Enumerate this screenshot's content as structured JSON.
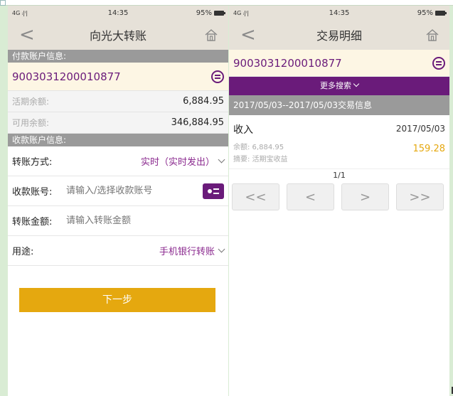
{
  "status": {
    "signal": "4G ᵢ|ⁱ|",
    "time": "14:35",
    "battery": "95%"
  },
  "left": {
    "title": "向光大转账",
    "payer_header": "付款账户信息:",
    "account": "9003031200010877",
    "current_label": "活期余额:",
    "current_value": "6,884.95",
    "available_label": "可用余额:",
    "available_value": "346,884.95",
    "payee_header": "收款账户信息:",
    "method_label": "转账方式:",
    "method_value": "实时（实时发出）",
    "payee_label": "收款账号:",
    "payee_placeholder": "请输入/选择收款账号",
    "amount_label": "转账金额:",
    "amount_placeholder": "请输入转账金额",
    "purpose_label": "用途:",
    "purpose_value": "手机银行转账",
    "next_label": "下一步"
  },
  "right": {
    "title": "交易明细",
    "account": "9003031200010877",
    "more_search": "更多搜索",
    "range": "2017/05/03--2017/05/03交易信息",
    "transactions": [
      {
        "type": "收入",
        "date": "2017/05/03",
        "balance": "余额: 6,884.95",
        "memo": "摘要: 活期宝收益",
        "amount": "159.28"
      }
    ],
    "page": "1/1",
    "pager": {
      "first": "<<",
      "prev": "<",
      "next": ">",
      "last": ">>"
    }
  },
  "colors": {
    "accent": "#6a1b7a",
    "gold": "#e5a80f",
    "header_gray": "#9a9a9a",
    "nav_bg": "#e6e1d8"
  }
}
